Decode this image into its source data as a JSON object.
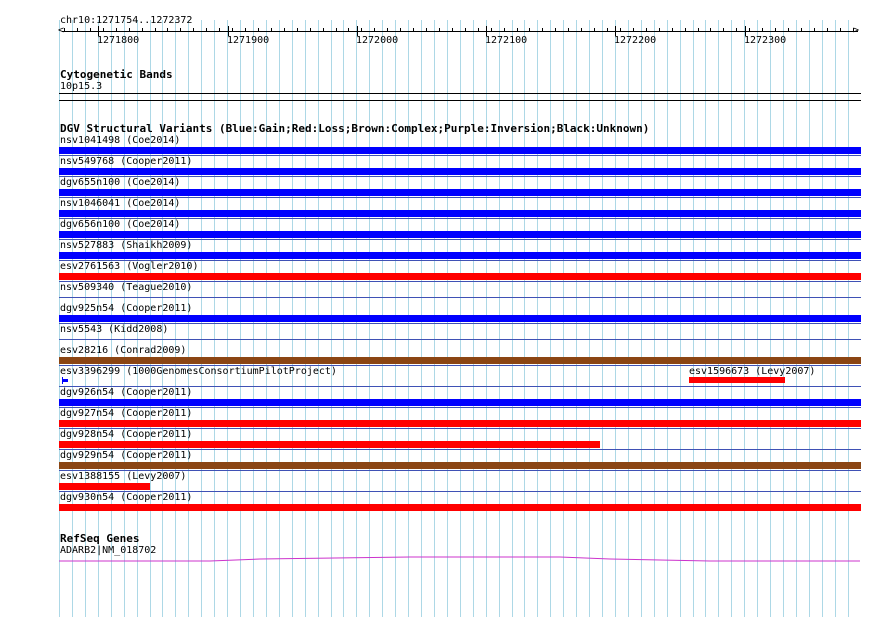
{
  "ruler": {
    "coordinate_label": "chr10:1271754..1272372",
    "ticks": [
      "1271800",
      "1271900",
      "1272000",
      "1272100",
      "1272200",
      "1272300"
    ]
  },
  "cytobands": {
    "title": "Cytogenetic Bands",
    "band": "10p15.3"
  },
  "dgv": {
    "title": "DGV Structural Variants (Blue:Gain;Red:Loss;Brown:Complex;Purple:Inversion;Black:Unknown)",
    "colors": {
      "blue": "#0000ff",
      "red": "#ff0000",
      "brown": "#8b4513"
    },
    "variants": [
      {
        "label": "nsv1041498 (Coe2014)",
        "color": "blue"
      },
      {
        "label": "nsv549768 (Cooper2011)",
        "color": "blue"
      },
      {
        "label": "dgv655n100 (Coe2014)",
        "color": "blue"
      },
      {
        "label": "nsv1046041 (Coe2014)",
        "color": "blue"
      },
      {
        "label": "dgv656n100 (Coe2014)",
        "color": "blue"
      },
      {
        "label": "nsv527883 (Shaikh2009)",
        "color": "blue"
      },
      {
        "label": "esv2761563 (Vogler2010)",
        "color": "red"
      },
      {
        "label": "nsv509340 (Teague2010)",
        "color": "blue"
      },
      {
        "label": "dgv925n54 (Cooper2011)",
        "color": "blue"
      },
      {
        "label": "nsv5543 (Kidd2008)",
        "color": "blue"
      },
      {
        "label": "esv28216 (Conrad2009)",
        "color": "brown"
      },
      {
        "label": "esv3396299 (1000GenomesConsortiumPilotProject)",
        "color": "blue"
      },
      {
        "label": "esv1596673 (Levy2007)",
        "color": "red"
      },
      {
        "label": "dgv926n54 (Cooper2011)",
        "color": "blue"
      },
      {
        "label": "dgv927n54 (Cooper2011)",
        "color": "red"
      },
      {
        "label": "dgv928n54 (Cooper2011)",
        "color": "red"
      },
      {
        "label": "dgv929n54 (Cooper2011)",
        "color": "brown"
      },
      {
        "label": "esv1388155 (Levy2007)",
        "color": "red"
      },
      {
        "label": "dgv930n54 (Cooper2011)",
        "color": "red"
      }
    ]
  },
  "refseq": {
    "title": "RefSeq Genes",
    "gene": "ADARB2|NM_018702",
    "color": "#cc33cc"
  },
  "grid_color": "#add8e6"
}
